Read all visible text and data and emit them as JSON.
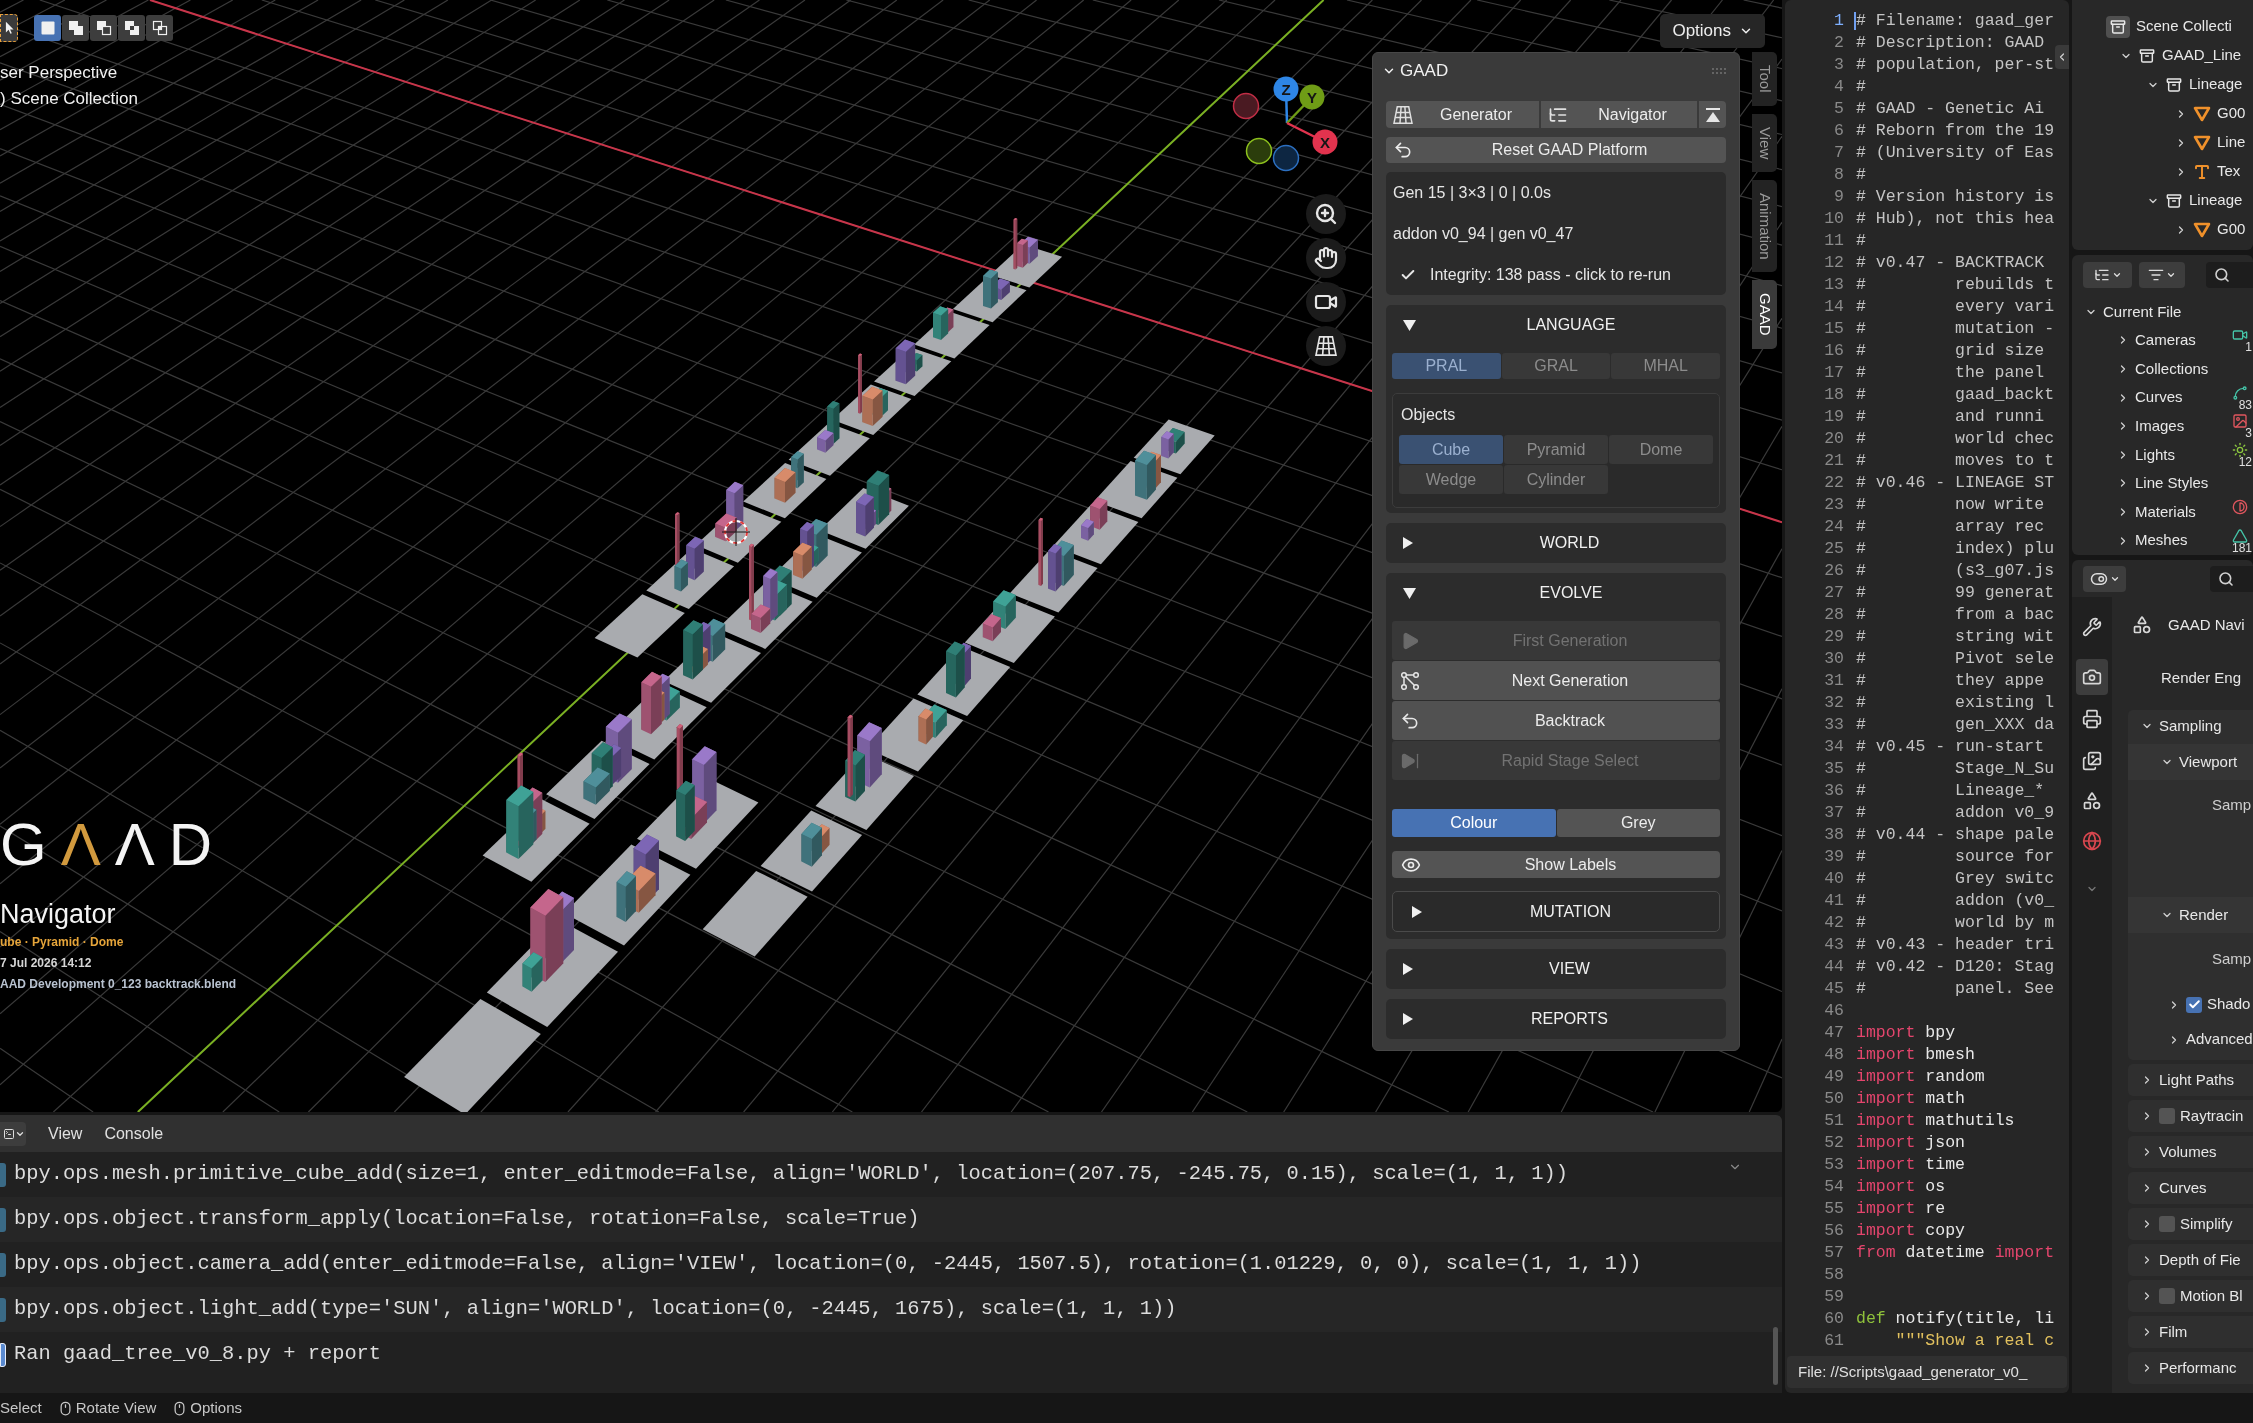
{
  "viewport": {
    "header": {
      "select_modes": [
        {
          "kind": "set",
          "selected": true
        },
        {
          "kind": "extend",
          "selected": false
        },
        {
          "kind": "subtract",
          "selected": false
        },
        {
          "kind": "invert",
          "selected": false
        },
        {
          "kind": "intersect",
          "selected": false
        }
      ],
      "options": "Options"
    },
    "view_info": [
      "ser Perspective",
      ") Scene Collection"
    ],
    "gizmo": {
      "axes": [
        {
          "label": "Z",
          "kind": "z"
        },
        {
          "label": "Y",
          "kind": "y"
        },
        {
          "label": "X",
          "kind": "x"
        }
      ]
    },
    "side_tabs": [
      {
        "label": "Tool",
        "selected": false
      },
      {
        "label": "View",
        "selected": false
      },
      {
        "label": "Animation",
        "selected": false
      },
      {
        "label": "GAAD",
        "selected": true
      }
    ],
    "stamp": {
      "logo": [
        {
          "char": "G",
          "accent": false
        },
        {
          "char": "Λ",
          "accent": true
        },
        {
          "char": "Λ",
          "accent": false
        },
        {
          "char": "D",
          "accent": false
        }
      ],
      "title": "Navigator",
      "shapes": "ube · Pyramid · Dome",
      "date": "7 Jul 2026 14:12",
      "file": "AAD Development 0_123 backtrack.blend"
    }
  },
  "gaad_panel": {
    "title": "GAAD",
    "expanded": true,
    "modes": [
      {
        "label": "Generator",
        "kind": "grid"
      },
      {
        "label": "Navigator",
        "kind": "tree"
      }
    ],
    "reset": "Reset GAAD Platform",
    "status": [
      "Gen 15 | 3×3 | 0 | 0.0s",
      "addon v0_94 | gen v0_47"
    ],
    "integrity": "Integrity: 138 pass - click to re-run",
    "sections": [
      {
        "kind": "language",
        "title": "LANGUAGE",
        "expanded": true,
        "languages": [
          {
            "label": "PRAL",
            "selected": true
          },
          {
            "label": "GRAL",
            "selected": false
          },
          {
            "label": "MHAL",
            "selected": false
          }
        ],
        "objects": {
          "title": "Objects",
          "items": [
            {
              "label": "Cube",
              "selected": true
            },
            {
              "label": "Pyramid",
              "selected": false
            },
            {
              "label": "Dome",
              "selected": false
            },
            {
              "label": "Wedge",
              "selected": false
            },
            {
              "label": "Cylinder",
              "selected": false
            }
          ]
        }
      },
      {
        "kind": "collapsible",
        "title": "WORLD",
        "expanded": false
      },
      {
        "kind": "evolve",
        "title": "EVOLVE",
        "expanded": true,
        "actions": [
          {
            "label": "First Generation",
            "kind": "play",
            "disabled": true
          },
          {
            "label": "Next Generation",
            "kind": "branch",
            "disabled": false
          },
          {
            "label": "Backtrack",
            "kind": "undo",
            "disabled": false
          },
          {
            "label": "Rapid Stage Select",
            "kind": "skip",
            "disabled": true
          }
        ],
        "colour_modes": [
          {
            "label": "Colour",
            "selected": true
          },
          {
            "label": "Grey",
            "selected": false
          }
        ],
        "show_labels": "Show Labels",
        "mutation": {
          "title": "MUTATION",
          "expanded": false
        }
      },
      {
        "kind": "collapsible",
        "title": "VIEW",
        "expanded": false
      },
      {
        "kind": "collapsible",
        "title": "REPORTS",
        "expanded": false
      }
    ]
  },
  "console": {
    "menus": [
      "View",
      "Console"
    ],
    "lines": [
      {
        "kind": "operator",
        "text": "bpy.ops.mesh.primitive_cube_add(size=1, enter_editmode=False, align='WORLD', location=(207.75, -245.75, 0.15), scale=(1, 1, 1))"
      },
      {
        "kind": "operator",
        "text": "bpy.ops.object.transform_apply(location=False, rotation=False, scale=True)"
      },
      {
        "kind": "operator",
        "text": "bpy.ops.object.camera_add(enter_editmode=False, align='VIEW', location=(0, -2445, 1507.5), rotation=(1.01229, 0, 0), scale=(1, 1, 1))"
      },
      {
        "kind": "operator",
        "text": "bpy.ops.object.light_add(type='SUN', align='WORLD', location=(0, -2445, 1675), scale=(1, 1, 1))"
      },
      {
        "kind": "info",
        "text": "Ran gaad_tree_v0_8.py + report"
      }
    ]
  },
  "text_editor": {
    "lines": [
      {
        "number": "1",
        "current": true,
        "tokens": [
          {
            "kind": "comment",
            "text": "# Filename: gaad_ger"
          }
        ]
      },
      {
        "number": "2",
        "current": false,
        "tokens": [
          {
            "kind": "comment",
            "text": "# Description: GAAD"
          }
        ]
      },
      {
        "number": "3",
        "current": false,
        "tokens": [
          {
            "kind": "comment",
            "text": "# population, per-st"
          }
        ]
      },
      {
        "number": "4",
        "current": false,
        "tokens": [
          {
            "kind": "comment",
            "text": "#"
          }
        ]
      },
      {
        "number": "5",
        "current": false,
        "tokens": [
          {
            "kind": "comment",
            "text": "# GAAD - Genetic Ai"
          }
        ]
      },
      {
        "number": "6",
        "current": false,
        "tokens": [
          {
            "kind": "comment",
            "text": "# Reborn from the 19"
          }
        ]
      },
      {
        "number": "7",
        "current": false,
        "tokens": [
          {
            "kind": "comment",
            "text": "# (University of Eas"
          }
        ]
      },
      {
        "number": "8",
        "current": false,
        "tokens": [
          {
            "kind": "comment",
            "text": "#"
          }
        ]
      },
      {
        "number": "9",
        "current": false,
        "tokens": [
          {
            "kind": "comment",
            "text": "# Version history is"
          }
        ]
      },
      {
        "number": "10",
        "current": false,
        "tokens": [
          {
            "kind": "comment",
            "text": "# Hub), not this hea"
          }
        ]
      },
      {
        "number": "11",
        "current": false,
        "tokens": [
          {
            "kind": "comment",
            "text": "#"
          }
        ]
      },
      {
        "number": "12",
        "current": false,
        "tokens": [
          {
            "kind": "comment",
            "text": "# v0.47 - BACKTRACK"
          }
        ]
      },
      {
        "number": "13",
        "current": false,
        "tokens": [
          {
            "kind": "comment",
            "text": "#         rebuilds t"
          }
        ]
      },
      {
        "number": "14",
        "current": false,
        "tokens": [
          {
            "kind": "comment",
            "text": "#         every vari"
          }
        ]
      },
      {
        "number": "15",
        "current": false,
        "tokens": [
          {
            "kind": "comment",
            "text": "#         mutation -"
          }
        ]
      },
      {
        "number": "16",
        "current": false,
        "tokens": [
          {
            "kind": "comment",
            "text": "#         grid size"
          }
        ]
      },
      {
        "number": "17",
        "current": false,
        "tokens": [
          {
            "kind": "comment",
            "text": "#         the panel"
          }
        ]
      },
      {
        "number": "18",
        "current": false,
        "tokens": [
          {
            "kind": "comment",
            "text": "#         gaad_backt"
          }
        ]
      },
      {
        "number": "19",
        "current": false,
        "tokens": [
          {
            "kind": "comment",
            "text": "#         and runni"
          }
        ]
      },
      {
        "number": "20",
        "current": false,
        "tokens": [
          {
            "kind": "comment",
            "text": "#         world chec"
          }
        ]
      },
      {
        "number": "21",
        "current": false,
        "tokens": [
          {
            "kind": "comment",
            "text": "#         moves to t"
          }
        ]
      },
      {
        "number": "22",
        "current": false,
        "tokens": [
          {
            "kind": "comment",
            "text": "# v0.46 - LINEAGE ST"
          }
        ]
      },
      {
        "number": "23",
        "current": false,
        "tokens": [
          {
            "kind": "comment",
            "text": "#         now write"
          }
        ]
      },
      {
        "number": "24",
        "current": false,
        "tokens": [
          {
            "kind": "comment",
            "text": "#         array rec"
          }
        ]
      },
      {
        "number": "25",
        "current": false,
        "tokens": [
          {
            "kind": "comment",
            "text": "#         index) plu"
          }
        ]
      },
      {
        "number": "26",
        "current": false,
        "tokens": [
          {
            "kind": "comment",
            "text": "#         (s3_g07.js"
          }
        ]
      },
      {
        "number": "27",
        "current": false,
        "tokens": [
          {
            "kind": "comment",
            "text": "#         99 generat"
          }
        ]
      },
      {
        "number": "28",
        "current": false,
        "tokens": [
          {
            "kind": "comment",
            "text": "#         from a bac"
          }
        ]
      },
      {
        "number": "29",
        "current": false,
        "tokens": [
          {
            "kind": "comment",
            "text": "#         string wit"
          }
        ]
      },
      {
        "number": "30",
        "current": false,
        "tokens": [
          {
            "kind": "comment",
            "text": "#         Pivot sele"
          }
        ]
      },
      {
        "number": "31",
        "current": false,
        "tokens": [
          {
            "kind": "comment",
            "text": "#         they appe"
          }
        ]
      },
      {
        "number": "32",
        "current": false,
        "tokens": [
          {
            "kind": "comment",
            "text": "#         existing l"
          }
        ]
      },
      {
        "number": "33",
        "current": false,
        "tokens": [
          {
            "kind": "comment",
            "text": "#         gen_XXX da"
          }
        ]
      },
      {
        "number": "34",
        "current": false,
        "tokens": [
          {
            "kind": "comment",
            "text": "# v0.45 - run-start"
          }
        ]
      },
      {
        "number": "35",
        "current": false,
        "tokens": [
          {
            "kind": "comment",
            "text": "#         Stage_N_Su"
          }
        ]
      },
      {
        "number": "36",
        "current": false,
        "tokens": [
          {
            "kind": "comment",
            "text": "#         Lineage_*"
          }
        ]
      },
      {
        "number": "37",
        "current": false,
        "tokens": [
          {
            "kind": "comment",
            "text": "#         addon v0_9"
          }
        ]
      },
      {
        "number": "38",
        "current": false,
        "tokens": [
          {
            "kind": "comment",
            "text": "# v0.44 - shape pale"
          }
        ]
      },
      {
        "number": "39",
        "current": false,
        "tokens": [
          {
            "kind": "comment",
            "text": "#         source for"
          }
        ]
      },
      {
        "number": "40",
        "current": false,
        "tokens": [
          {
            "kind": "comment",
            "text": "#         Grey switc"
          }
        ]
      },
      {
        "number": "41",
        "current": false,
        "tokens": [
          {
            "kind": "comment",
            "text": "#         addon (v0_"
          }
        ]
      },
      {
        "number": "42",
        "current": false,
        "tokens": [
          {
            "kind": "comment",
            "text": "#         world by m"
          }
        ]
      },
      {
        "number": "43",
        "current": false,
        "tokens": [
          {
            "kind": "comment",
            "text": "# v0.43 - header tri"
          }
        ]
      },
      {
        "number": "44",
        "current": false,
        "tokens": [
          {
            "kind": "comment",
            "text": "# v0.42 - D120: Stag"
          }
        ]
      },
      {
        "number": "45",
        "current": false,
        "tokens": [
          {
            "kind": "comment",
            "text": "#         panel. See"
          }
        ]
      },
      {
        "number": "46",
        "current": false
      },
      {
        "number": "47",
        "current": false,
        "tokens": [
          {
            "kind": "keyword",
            "text": "import"
          },
          {
            "kind": "plain",
            "text": " bpy"
          }
        ]
      },
      {
        "number": "48",
        "current": false,
        "tokens": [
          {
            "kind": "keyword",
            "text": "import"
          },
          {
            "kind": "plain",
            "text": " bmesh"
          }
        ]
      },
      {
        "number": "49",
        "current": false,
        "tokens": [
          {
            "kind": "keyword",
            "text": "import"
          },
          {
            "kind": "plain",
            "text": " random"
          }
        ]
      },
      {
        "number": "50",
        "current": false,
        "tokens": [
          {
            "kind": "keyword",
            "text": "import"
          },
          {
            "kind": "plain",
            "text": " math"
          }
        ]
      },
      {
        "number": "51",
        "current": false,
        "tokens": [
          {
            "kind": "keyword",
            "text": "import"
          },
          {
            "kind": "plain",
            "text": " mathutils"
          }
        ]
      },
      {
        "number": "52",
        "current": false,
        "tokens": [
          {
            "kind": "keyword",
            "text": "import"
          },
          {
            "kind": "plain",
            "text": " json"
          }
        ]
      },
      {
        "number": "53",
        "current": false,
        "tokens": [
          {
            "kind": "keyword",
            "text": "import"
          },
          {
            "kind": "plain",
            "text": " time"
          }
        ]
      },
      {
        "number": "54",
        "current": false,
        "tokens": [
          {
            "kind": "keyword",
            "text": "import"
          },
          {
            "kind": "plain",
            "text": " os"
          }
        ]
      },
      {
        "number": "55",
        "current": false,
        "tokens": [
          {
            "kind": "keyword",
            "text": "import"
          },
          {
            "kind": "plain",
            "text": " re"
          }
        ]
      },
      {
        "number": "56",
        "current": false,
        "tokens": [
          {
            "kind": "keyword",
            "text": "import"
          },
          {
            "kind": "plain",
            "text": " copy"
          }
        ]
      },
      {
        "number": "57",
        "current": false,
        "tokens": [
          {
            "kind": "keyword",
            "text": "from"
          },
          {
            "kind": "plain",
            "text": " datetime "
          },
          {
            "kind": "keyword",
            "text": "import"
          }
        ]
      },
      {
        "number": "58",
        "current": false
      },
      {
        "number": "59",
        "current": false
      },
      {
        "number": "60",
        "current": false,
        "tokens": [
          {
            "kind": "def",
            "text": "def"
          },
          {
            "kind": "plain",
            "text": " notify(title, li"
          }
        ]
      },
      {
        "number": "61",
        "current": false,
        "tokens": [
          {
            "kind": "string",
            "text": "    \"\"\"Show a real c"
          }
        ]
      }
    ],
    "footer": "File: //Scripts\\gaad_generator_v0_"
  },
  "outliner": {
    "items": [
      {
        "label": "Scene Collecti",
        "kind": "scene_collection",
        "children": [
          {
            "label": "GAAD_Line",
            "kind": "collection",
            "expanded": true,
            "children": [
              {
                "label": "Lineage",
                "kind": "collection",
                "expanded": true,
                "children": [
                  {
                    "label": "G00",
                    "kind": "object",
                    "expanded": false
                  },
                  {
                    "label": "Line",
                    "kind": "object",
                    "expanded": false
                  },
                  {
                    "label": "Tex",
                    "kind": "text",
                    "expanded": false
                  }
                ]
              },
              {
                "label": "Lineage",
                "kind": "collection",
                "expanded": true,
                "children": [
                  {
                    "label": "G00",
                    "kind": "object",
                    "expanded": false
                  }
                ]
              }
            ]
          }
        ]
      }
    ]
  },
  "data_browser": {
    "root": {
      "label": "Current File",
      "expanded": true
    },
    "items": [
      {
        "label": "Cameras",
        "kind": "camera",
        "expanded": false,
        "count": "1"
      },
      {
        "label": "Collections",
        "kind": "none",
        "expanded": false
      },
      {
        "label": "Curves",
        "kind": "curve",
        "expanded": false,
        "count": "83"
      },
      {
        "label": "Images",
        "kind": "image",
        "expanded": false,
        "count": "3"
      },
      {
        "label": "Lights",
        "kind": "light",
        "expanded": false,
        "count": "12"
      },
      {
        "label": "Line Styles",
        "kind": "none",
        "expanded": false
      },
      {
        "label": "Materials",
        "kind": "material",
        "expanded": false
      },
      {
        "label": "Meshes",
        "kind": "mesh",
        "expanded": false,
        "count": "181"
      }
    ]
  },
  "properties": {
    "tabs": [
      {
        "kind": "tool",
        "selected": false
      },
      {
        "kind": "render",
        "selected": true
      },
      {
        "kind": "output",
        "selected": false
      },
      {
        "kind": "view_layer",
        "selected": false
      },
      {
        "kind": "scene",
        "selected": false
      },
      {
        "kind": "world",
        "selected": false
      }
    ],
    "context": "GAAD Navi",
    "engine_label": "Render Eng",
    "panels": [
      {
        "label": "Sampling",
        "kind": "plain",
        "expanded": true,
        "children": [
          {
            "label": "Viewport",
            "kind": "plain",
            "expanded": true,
            "fields": [
              "Samp"
            ]
          },
          {
            "label": "Render",
            "kind": "plain",
            "expanded": true,
            "fields": [
              "Samp"
            ],
            "children": [
              {
                "label": "Shado",
                "kind": "checkbox",
                "checked": true,
                "expanded": false
              },
              {
                "label": "Advanced",
                "kind": "plain",
                "expanded": false
              }
            ]
          }
        ]
      },
      {
        "label": "Light Paths",
        "kind": "plain",
        "expanded": false
      },
      {
        "label": "Raytracin",
        "kind": "checkbox",
        "checked": false,
        "expanded": false
      },
      {
        "label": "Volumes",
        "kind": "plain",
        "expanded": false
      },
      {
        "label": "Curves",
        "kind": "plain",
        "expanded": false
      },
      {
        "label": "Simplify",
        "kind": "checkbox",
        "checked": false,
        "expanded": false
      },
      {
        "label": "Depth of Fie",
        "kind": "plain",
        "expanded": false
      },
      {
        "label": "Motion Bl",
        "kind": "checkbox",
        "checked": false,
        "expanded": false
      },
      {
        "label": "Film",
        "kind": "plain",
        "expanded": false
      },
      {
        "label": "Performanc",
        "kind": "plain",
        "expanded": false
      }
    ]
  },
  "status_bar": [
    {
      "label": "Select",
      "kind": "plain"
    },
    {
      "label": "Rotate View",
      "kind": "mouse"
    },
    {
      "label": "Options",
      "kind": "mouse"
    }
  ]
}
